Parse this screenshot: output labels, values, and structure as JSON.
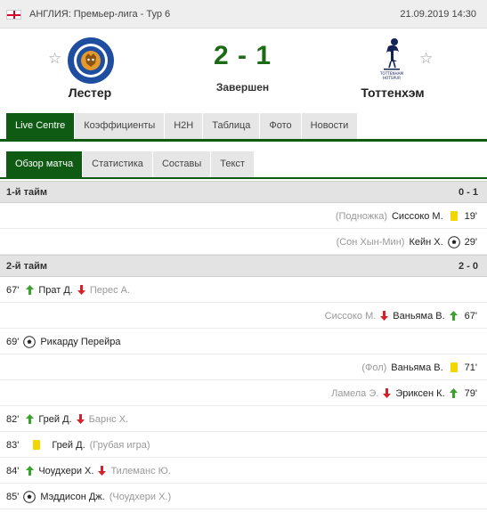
{
  "topbar": {
    "league": "АНГЛИЯ: Премьер-лига - Тур 6",
    "datetime": "21.09.2019 14:30"
  },
  "match": {
    "home_team": "Лестер",
    "away_team": "Тоттенхэм",
    "score": "2 - 1",
    "status": "Завершен"
  },
  "tabs_main": [
    "Live Centre",
    "Коэффициенты",
    "H2H",
    "Таблица",
    "Фото",
    "Новости"
  ],
  "tabs_sub": [
    "Обзор матча",
    "Статистика",
    "Составы",
    "Текст"
  ],
  "sections": [
    {
      "label": "1-й тайм",
      "score": "0 - 1"
    },
    {
      "label": "2-й тайм",
      "score": "2 - 0"
    }
  ],
  "events_half1": [
    {
      "side": "away",
      "type": "yellow-card",
      "player": "Сиссоко М.",
      "detail": "(Подножка)",
      "minute": "19'"
    },
    {
      "side": "away",
      "type": "goal",
      "player": "Кейн Х.",
      "detail": "(Сон Хын-Мин)",
      "minute": "29'"
    }
  ],
  "events_half2": [
    {
      "side": "home",
      "type": "substitution",
      "minute": "67'",
      "player_in": "Прат Д.",
      "player_out": "Перес А."
    },
    {
      "side": "away",
      "type": "substitution",
      "minute": "67'",
      "player_in": "Ваньяма В.",
      "player_out": "Сиссоко М."
    },
    {
      "side": "home",
      "type": "goal",
      "minute": "69'",
      "player": "Рикарду Перейра"
    },
    {
      "side": "away",
      "type": "yellow-card",
      "minute": "71'",
      "player": "Ваньяма В.",
      "detail": "(Фол)"
    },
    {
      "side": "away",
      "type": "substitution",
      "minute": "79'",
      "player_in": "Эриксен К.",
      "player_out": "Ламела Э."
    },
    {
      "side": "home",
      "type": "substitution",
      "minute": "82'",
      "player_in": "Грей Д.",
      "player_out": "Барнс Х."
    },
    {
      "side": "home",
      "type": "yellow-card",
      "minute": "83'",
      "player": "Грей Д.",
      "detail": "(Грубая игра)"
    },
    {
      "side": "home",
      "type": "substitution",
      "minute": "84'",
      "player_in": "Чоудхери Х.",
      "player_out": "Тилеманс Ю."
    },
    {
      "side": "home",
      "type": "goal",
      "minute": "85'",
      "player": "Мэддисон Дж.",
      "detail": "(Чоудхери Х.)"
    }
  ],
  "colors": {
    "accent_green": "#0f5b14",
    "score_green": "#1a6b14",
    "yellow_card": "#f2d600",
    "sub_in": "#3aa32b",
    "sub_out": "#d6202a"
  },
  "icons": [
    "england-flag-icon",
    "favorite-star-icon",
    "leicester-crest-icon",
    "tottenham-crest-icon",
    "yellow-card-icon",
    "ball-icon",
    "sub-in-arrow-icon",
    "sub-out-arrow-icon"
  ]
}
